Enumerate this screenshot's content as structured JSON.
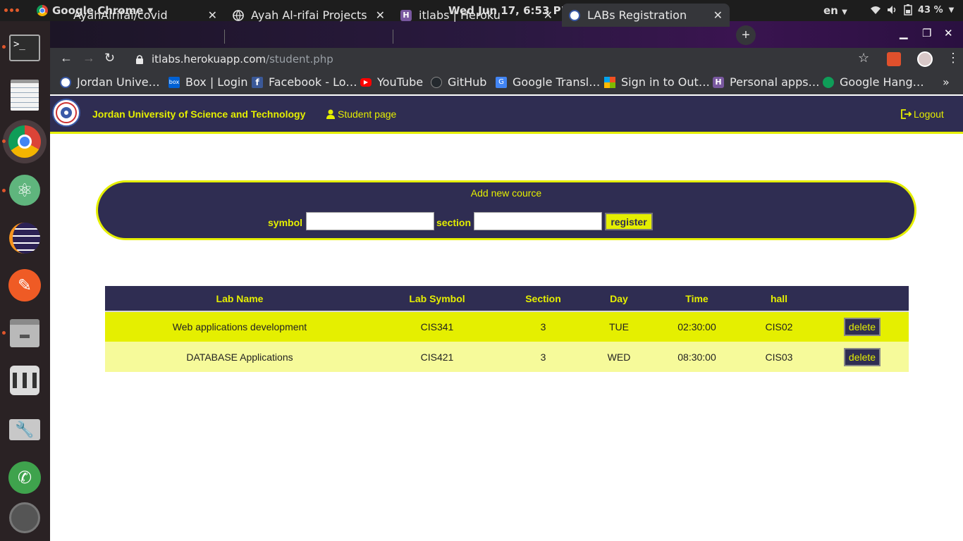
{
  "system": {
    "app_name": "Google Chrome",
    "clock": "Wed Jun 17,  6:53 PM",
    "language": "en",
    "battery": "43 %"
  },
  "browser": {
    "tabs": [
      {
        "title": "AyahAlrifai/covid"
      },
      {
        "title": "Ayah Al-rifai Projects"
      },
      {
        "title": "itlabs | Heroku"
      },
      {
        "title": "LABs Registration"
      }
    ],
    "address": {
      "host": "itlabs.herokuapp.com",
      "path": "/student.php"
    },
    "bookmarks": [
      {
        "label": "Jordan Unive…"
      },
      {
        "label": "Box | Login"
      },
      {
        "label": "Facebook - Lo…"
      },
      {
        "label": "YouTube"
      },
      {
        "label": "GitHub"
      },
      {
        "label": "Google Transl…"
      },
      {
        "label": "Sign in to Out…"
      },
      {
        "label": "Personal apps…"
      },
      {
        "label": "Google Hang…"
      }
    ],
    "bookmarks_overflow": "»"
  },
  "site": {
    "brand": "Jordan University of Science and Technology",
    "student_link": "Student page",
    "logout": "Logout"
  },
  "form": {
    "title": "Add new cource",
    "symbol_label": "symbol",
    "symbol_value": "",
    "section_label": "section",
    "section_value": "",
    "register_label": "register"
  },
  "table": {
    "headers": [
      "Lab Name",
      "Lab Symbol",
      "Section",
      "Day",
      "Time",
      "hall",
      ""
    ],
    "rows": [
      [
        "Web applications development",
        "CIS341",
        "3",
        "TUE",
        "02:30:00",
        "CIS02"
      ],
      [
        "DATABASE Applications",
        "CIS421",
        "3",
        "WED",
        "08:30:00",
        "CIS03"
      ]
    ],
    "delete_label": "delete"
  },
  "colors": {
    "navy": "#2f2d52",
    "accent_yellow": "#e5ef00",
    "row_light": "#f6fa9a"
  }
}
